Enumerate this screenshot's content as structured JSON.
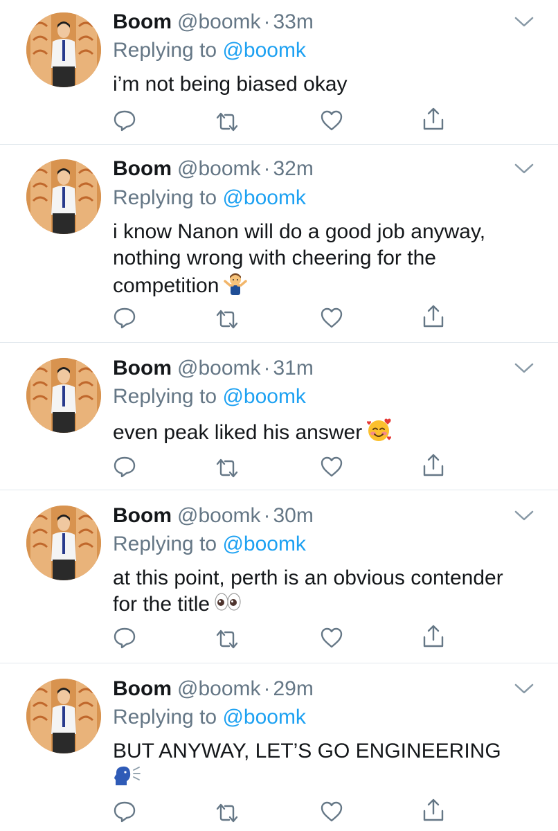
{
  "tweets": [
    {
      "name": "Boom",
      "handle": "@boomk",
      "time": "33m",
      "replying_prefix": "Replying to",
      "replying_to": "@boomk",
      "text_lines": [
        "i’m not being biased okay"
      ],
      "emoji": ""
    },
    {
      "name": "Boom",
      "handle": "@boomk",
      "time": "32m",
      "replying_prefix": "Replying to",
      "replying_to": "@boomk",
      "text_lines": [
        "i know Nanon will do a good job anyway,",
        "nothing wrong with cheering for the",
        "competition"
      ],
      "emoji": "man-shrugging"
    },
    {
      "name": "Boom",
      "handle": "@boomk",
      "time": "31m",
      "replying_prefix": "Replying to",
      "replying_to": "@boomk",
      "text_lines": [
        "even peak liked his answer"
      ],
      "emoji": "smiling-face-with-hearts"
    },
    {
      "name": "Boom",
      "handle": "@boomk",
      "time": "30m",
      "replying_prefix": "Replying to",
      "replying_to": "@boomk",
      "text_lines": [
        "at this point, perth is an obvious contender",
        "for the title"
      ],
      "emoji": "eyes"
    },
    {
      "name": "Boom",
      "handle": "@boomk",
      "time": "29m",
      "replying_prefix": "Replying to",
      "replying_to": "@boomk",
      "text_lines": [
        "BUT ANYWAY, LET’S GO ENGINEERING"
      ],
      "emoji": "speaking-head"
    }
  ],
  "colors": {
    "text": "#14171a",
    "secondary": "#657786",
    "link": "#1da1f2",
    "divider": "#e1e8ed"
  },
  "icons": [
    "reply-icon",
    "retweet-icon",
    "like-icon",
    "share-icon",
    "chevron-down-icon"
  ]
}
